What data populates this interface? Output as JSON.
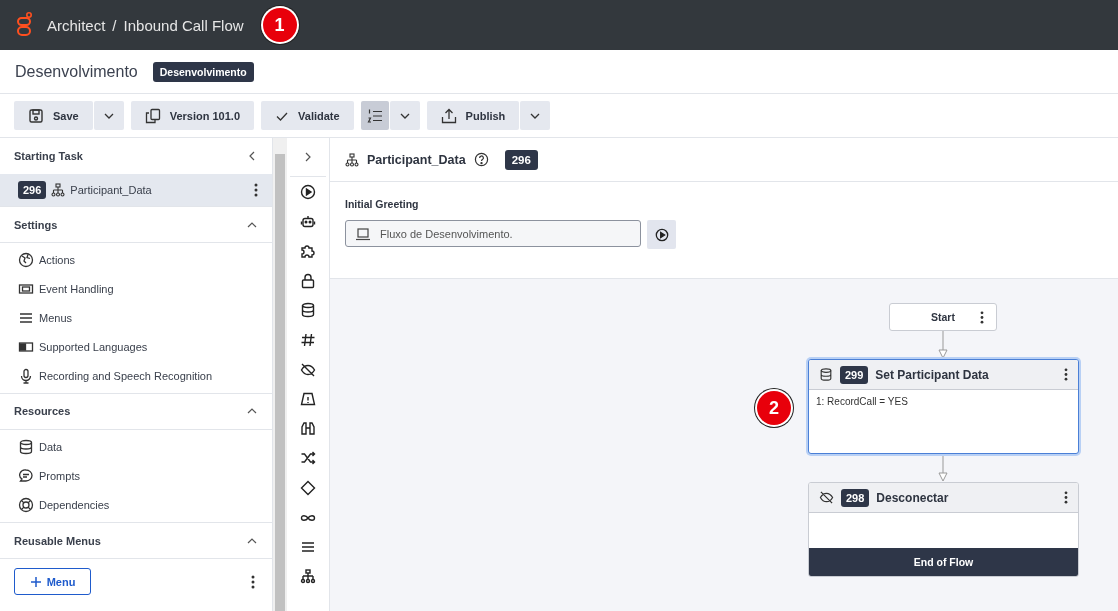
{
  "header": {
    "breadcrumb": [
      "Architect",
      "Inbound Call Flow"
    ],
    "separator": "/",
    "callout": "1"
  },
  "title": {
    "text": "Desenvolvimento",
    "badge": "Desenvolvimento"
  },
  "toolbar": [
    {
      "label": "Save",
      "split": true,
      "selected": false
    },
    {
      "label": "Version 101.0",
      "split": false,
      "selected": false
    },
    {
      "label": "Validate",
      "split": false,
      "selected": false
    },
    {
      "split": true,
      "selected": true
    },
    {
      "label": "Publish",
      "split": true,
      "selected": false
    }
  ],
  "sidebar": {
    "starting_task": {
      "heading": "Starting Task",
      "number": "296",
      "label": "Participant_Data",
      "selected": true
    },
    "sections": [
      {
        "title": "Settings",
        "expanded": true,
        "items": [
          "Actions",
          "Event Handling",
          "Menus",
          "Supported Languages",
          "Recording and Speech Recognition"
        ]
      },
      {
        "title": "Resources",
        "expanded": true,
        "items": [
          "Data",
          "Prompts",
          "Dependencies"
        ]
      },
      {
        "title": "Reusable Menus",
        "expanded": true,
        "button": "Menu"
      }
    ]
  },
  "task": {
    "title": "Participant_Data",
    "number": "296",
    "greeting_label": "Initial Greeting",
    "greeting_value": "Fluxo de Desenvolvimento."
  },
  "flow": {
    "start": "Start",
    "callout": "2",
    "nodes": [
      {
        "number": "299",
        "title": "Set Participant Data",
        "selected": true,
        "lines": [
          "1: RecordCall = YES"
        ]
      },
      {
        "number": "298",
        "title": "Desconectar",
        "selected": false,
        "footer": "End of Flow"
      }
    ]
  }
}
